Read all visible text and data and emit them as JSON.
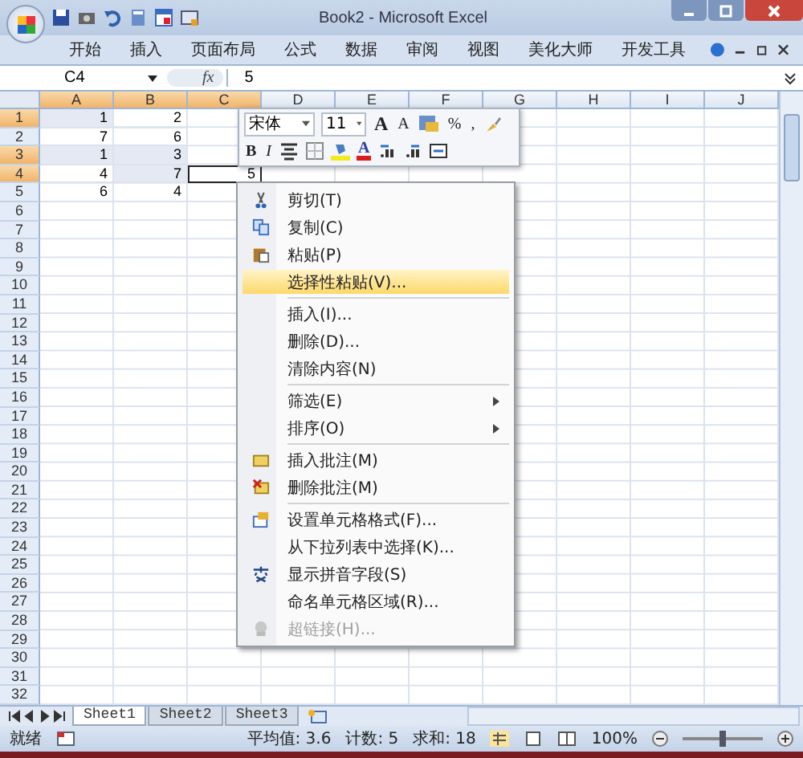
{
  "window": {
    "title": "Book2 - Microsoft Excel"
  },
  "ribbon_tabs": [
    "开始",
    "插入",
    "页面布局",
    "公式",
    "数据",
    "审阅",
    "视图",
    "美化大师",
    "开发工具"
  ],
  "formula_bar": {
    "name_box": "C4",
    "fx": "fx",
    "value": "5"
  },
  "columns": [
    {
      "label": "A",
      "selected": true
    },
    {
      "label": "B",
      "selected": true
    },
    {
      "label": "C",
      "selected": true
    },
    {
      "label": "D",
      "selected": false
    },
    {
      "label": "E",
      "selected": false
    },
    {
      "label": "F",
      "selected": false
    },
    {
      "label": "G",
      "selected": false
    },
    {
      "label": "H",
      "selected": false
    },
    {
      "label": "I",
      "selected": false
    },
    {
      "label": "J",
      "selected": false
    }
  ],
  "rows": [
    {
      "header": "1",
      "selected": true,
      "cells": [
        {
          "value": "1",
          "selected": true,
          "active": false
        },
        {
          "value": "2",
          "selected": false,
          "active": false
        }
      ]
    },
    {
      "header": "2",
      "selected": false,
      "cells": [
        {
          "value": "7",
          "selected": false,
          "active": false
        },
        {
          "value": "6",
          "selected": false,
          "active": false
        }
      ]
    },
    {
      "header": "3",
      "selected": true,
      "cells": [
        {
          "value": "1",
          "selected": true,
          "active": false
        },
        {
          "value": "3",
          "selected": true,
          "active": false
        }
      ]
    },
    {
      "header": "4",
      "selected": true,
      "cells": [
        {
          "value": "4",
          "selected": false,
          "active": false
        },
        {
          "value": "7",
          "selected": true,
          "active": false
        },
        {
          "value": "5",
          "selected": false,
          "active": true
        }
      ]
    },
    {
      "header": "5",
      "selected": false,
      "cells": [
        {
          "value": "6",
          "selected": false,
          "active": false
        },
        {
          "value": "4",
          "selected": false,
          "active": false
        }
      ]
    },
    {
      "header": "6",
      "selected": false
    },
    {
      "header": "7",
      "selected": false
    },
    {
      "header": "8",
      "selected": false
    },
    {
      "header": "9",
      "selected": false
    },
    {
      "header": "10",
      "selected": false
    },
    {
      "header": "11",
      "selected": false
    },
    {
      "header": "12",
      "selected": false
    },
    {
      "header": "13",
      "selected": false
    },
    {
      "header": "14",
      "selected": false
    },
    {
      "header": "15",
      "selected": false
    },
    {
      "header": "16",
      "selected": false
    },
    {
      "header": "17",
      "selected": false
    },
    {
      "header": "18",
      "selected": false
    },
    {
      "header": "19",
      "selected": false
    },
    {
      "header": "20",
      "selected": false
    },
    {
      "header": "21",
      "selected": false
    },
    {
      "header": "22",
      "selected": false
    },
    {
      "header": "23",
      "selected": false
    },
    {
      "header": "24",
      "selected": false
    },
    {
      "header": "25",
      "selected": false
    },
    {
      "header": "26",
      "selected": false
    },
    {
      "header": "27",
      "selected": false
    },
    {
      "header": "28",
      "selected": false
    },
    {
      "header": "29",
      "selected": false
    },
    {
      "header": "30",
      "selected": false
    },
    {
      "header": "31",
      "selected": false
    },
    {
      "header": "32",
      "selected": false
    }
  ],
  "mini_toolbar": {
    "font": "宋体",
    "size": "11",
    "grow": "A",
    "shrink": "A",
    "percent": "%",
    "comma": ",",
    "bold": "B",
    "italic": "I",
    "font_color": "A"
  },
  "context_menu": [
    {
      "kind": "cut",
      "label": "剪切(T)",
      "selected": false,
      "disabled": false,
      "submenu": false,
      "separator_after": false
    },
    {
      "kind": "copy",
      "label": "复制(C)",
      "selected": false,
      "disabled": false,
      "submenu": false,
      "separator_after": false
    },
    {
      "kind": "paste",
      "label": "粘贴(P)",
      "selected": false,
      "disabled": false,
      "submenu": false,
      "separator_after": false
    },
    {
      "kind": "plain",
      "label": "选择性粘贴(V)...",
      "selected": true,
      "disabled": false,
      "submenu": false,
      "separator_after": true
    },
    {
      "kind": "plain",
      "label": "插入(I)...",
      "selected": false,
      "disabled": false,
      "submenu": false,
      "separator_after": false
    },
    {
      "kind": "plain",
      "label": "删除(D)...",
      "selected": false,
      "disabled": false,
      "submenu": false,
      "separator_after": false
    },
    {
      "kind": "plain",
      "label": "清除内容(N)",
      "selected": false,
      "disabled": false,
      "submenu": false,
      "separator_after": true
    },
    {
      "kind": "plain",
      "label": "筛选(E)",
      "selected": false,
      "disabled": false,
      "submenu": true,
      "separator_after": false
    },
    {
      "kind": "plain",
      "label": "排序(O)",
      "selected": false,
      "disabled": false,
      "submenu": true,
      "separator_after": true
    },
    {
      "kind": "note-add",
      "label": "插入批注(M)",
      "selected": false,
      "disabled": false,
      "submenu": false,
      "separator_after": false
    },
    {
      "kind": "note-delete",
      "label": "删除批注(M)",
      "selected": false,
      "disabled": false,
      "submenu": false,
      "separator_after": true
    },
    {
      "kind": "format",
      "label": "设置单元格格式(F)...",
      "selected": false,
      "disabled": false,
      "submenu": false,
      "separator_after": false
    },
    {
      "kind": "plain",
      "label": "从下拉列表中选择(K)...",
      "selected": false,
      "disabled": false,
      "submenu": false,
      "separator_after": false
    },
    {
      "kind": "pinyin",
      "label": "显示拼音字段(S)",
      "selected": false,
      "disabled": false,
      "submenu": false,
      "separator_after": false
    },
    {
      "kind": "plain",
      "label": "命名单元格区域(R)...",
      "selected": false,
      "disabled": false,
      "submenu": false,
      "separator_after": false
    },
    {
      "kind": "link",
      "label": "超链接(H)...",
      "selected": false,
      "disabled": true,
      "submenu": false,
      "separator_after": false
    }
  ],
  "sheet_tabs": [
    {
      "label": "Sheet1",
      "selected": true
    },
    {
      "label": "Sheet2",
      "selected": false
    },
    {
      "label": "Sheet3",
      "selected": false
    }
  ],
  "status_bar": {
    "ready": "就绪",
    "average": "平均值: 3.6",
    "count": "计数: 5",
    "sum": "求和: 18",
    "zoom": "100%",
    "zoom_slider": {
      "level": 0.5
    }
  }
}
